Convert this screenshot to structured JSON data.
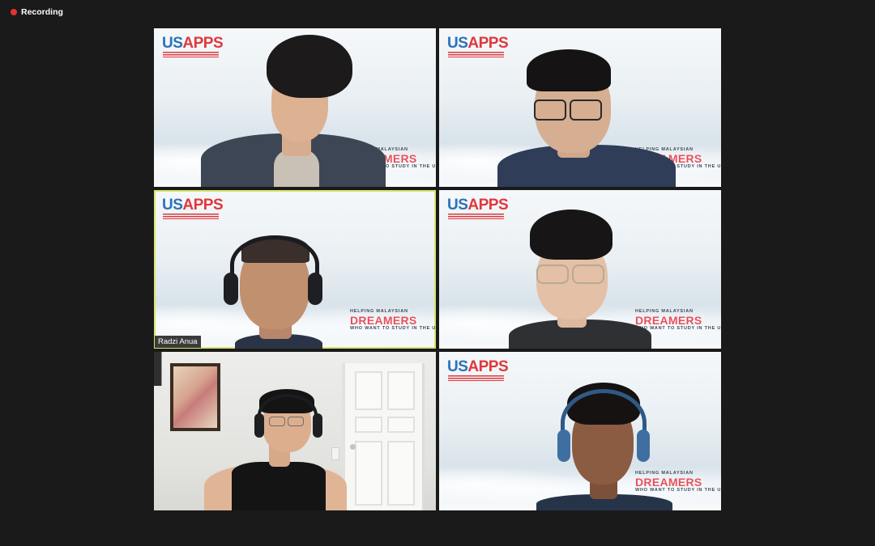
{
  "recording": {
    "label": "Recording",
    "color": "#e5322d"
  },
  "branding": {
    "logo_us": "US",
    "logo_apps": "APPS",
    "slogan_top": "HELPING MALAYSIAN",
    "slogan_main": "DREAMERS",
    "slogan_bottom": "WHO WANT TO STUDY IN THE USA"
  },
  "tiles": [
    {
      "id": "tile-1",
      "background": "virtual",
      "active": false,
      "name": ""
    },
    {
      "id": "tile-2",
      "background": "virtual",
      "active": false,
      "name": ""
    },
    {
      "id": "tile-3",
      "background": "virtual",
      "active": true,
      "name": "Radzi Anua"
    },
    {
      "id": "tile-4",
      "background": "virtual",
      "active": false,
      "name": ""
    },
    {
      "id": "tile-5",
      "background": "room",
      "active": false,
      "name": ""
    },
    {
      "id": "tile-6",
      "background": "virtual",
      "active": false,
      "name": ""
    }
  ],
  "colors": {
    "app_background": "#1a1a1a",
    "active_speaker_border": "#d8e56e",
    "logo_blue": "#2b72b8",
    "logo_red": "#e0383c"
  }
}
